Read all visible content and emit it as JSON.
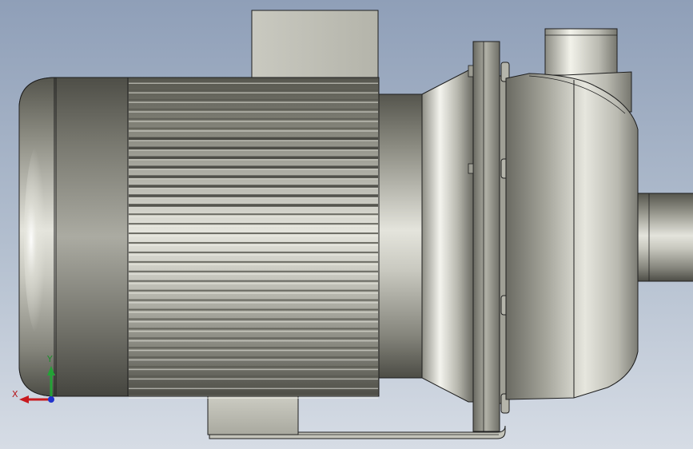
{
  "scene": {
    "subject": "centrifugal-pump-motor-assembly",
    "colors": {
      "background_top": "#8f9fb8",
      "background_bottom": "#d6dce5",
      "metal_dark": "#5d5d55",
      "metal_mid": "#a8a89e",
      "metal_light": "#f2f2ea",
      "outline": "#1e1e1e"
    }
  },
  "triad": {
    "x_label": "X",
    "y_label": "Y",
    "x_color": "#c81a1f",
    "y_color": "#23a236",
    "z_color": "#2233cc"
  }
}
